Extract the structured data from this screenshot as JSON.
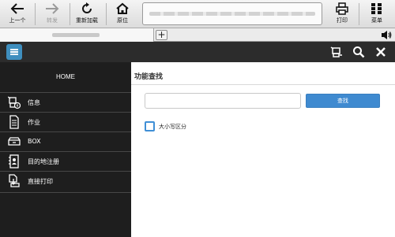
{
  "toolbar": {
    "back_label": "上一个",
    "forward_label": "转发",
    "reload_label": "重新加载",
    "home_label": "原位",
    "print_label": "打印",
    "menu_label": "菜单",
    "address_value": ""
  },
  "tabbar": {
    "add_tab_label": "+"
  },
  "sidebar": {
    "home_label": "HOME",
    "items": [
      {
        "label": "信息",
        "icon": "info-icon"
      },
      {
        "label": "作业",
        "icon": "document-icon"
      },
      {
        "label": "BOX",
        "icon": "box-icon"
      },
      {
        "label": "目的地注册",
        "icon": "address-book-icon"
      },
      {
        "label": "直接打印",
        "icon": "direct-print-icon"
      }
    ]
  },
  "main": {
    "title": "功能查找",
    "search_placeholder": "",
    "search_button_label": "查找",
    "case_sensitive_label": "大小写区分",
    "case_sensitive_checked": false
  },
  "colors": {
    "accent": "#3f8ad0",
    "header_bg": "#2c2c2c",
    "sidebar_bg": "#1e1e1e"
  }
}
